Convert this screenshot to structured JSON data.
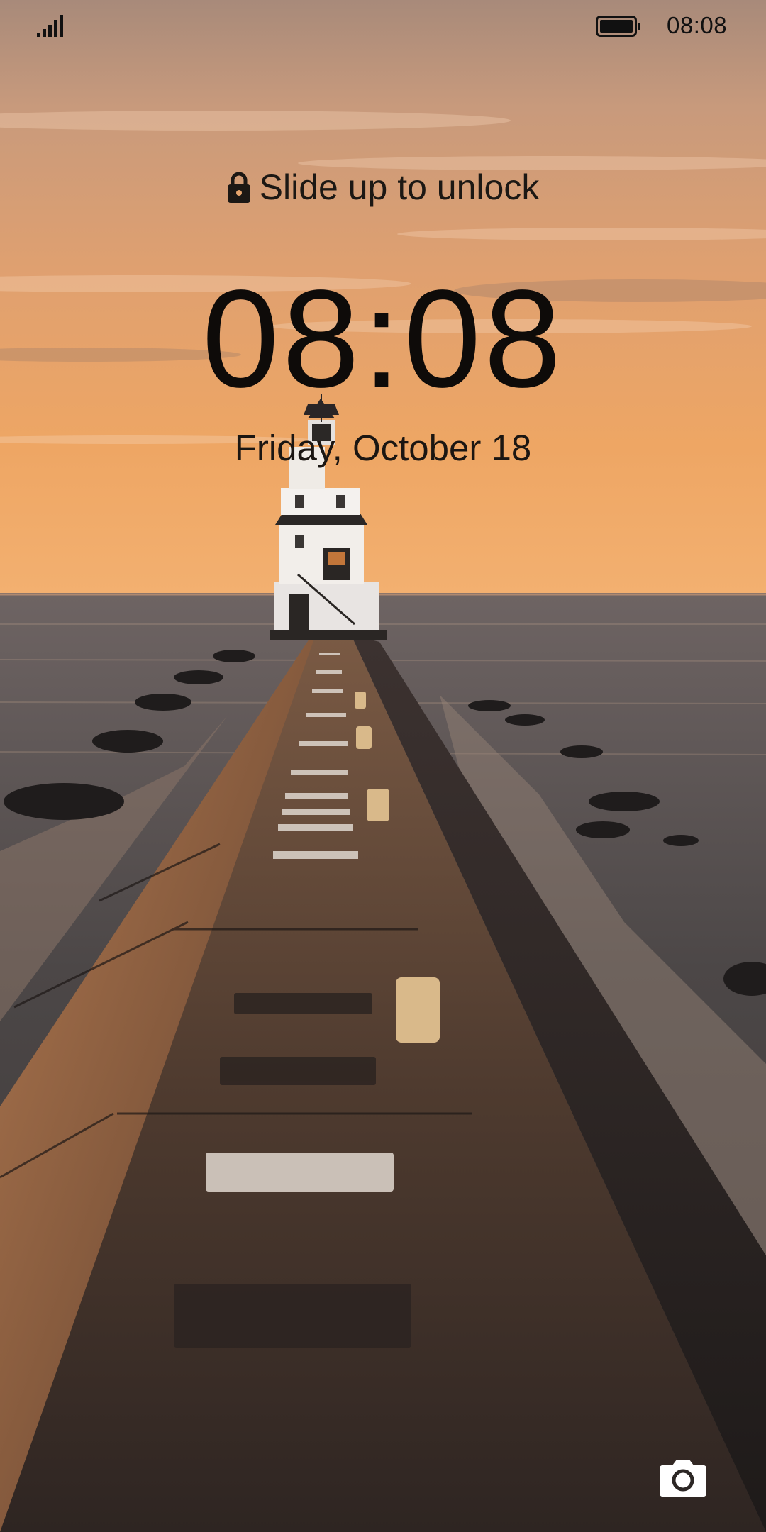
{
  "status_bar": {
    "time": "08:08",
    "signal_icon": "cellular-signal-icon",
    "battery_icon": "battery-full-icon"
  },
  "lockscreen": {
    "unlock_hint": "Slide up to unlock",
    "lock_icon": "lock-icon",
    "clock": "08:08",
    "date": "Friday, October 18",
    "camera_icon": "camera-icon"
  },
  "wallpaper": {
    "subject": "lighthouse at end of pier at sunset",
    "colors": {
      "sky_top": "#b48c74",
      "sky_mid": "#e2a06a",
      "horizon": "#f0a868",
      "sea": "#4a4644",
      "pier": "#5b4232"
    }
  }
}
